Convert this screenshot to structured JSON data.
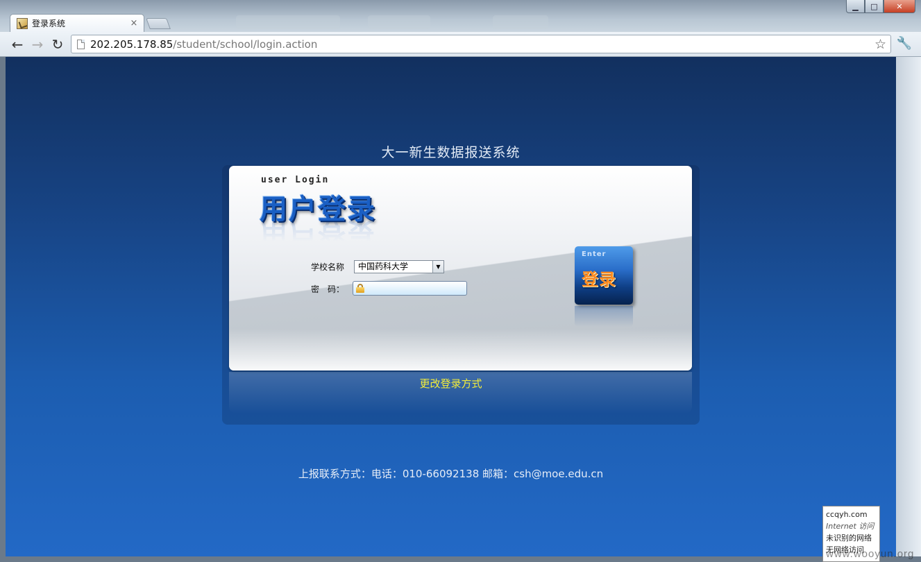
{
  "browser": {
    "tab_title": "登录系统",
    "tab_close": "×",
    "url_host": "202.205.178.85",
    "url_path": "/student/school/login.action",
    "back_glyph": "←",
    "forward_glyph": "→",
    "reload_glyph": "↻",
    "star_glyph": "☆",
    "wrench_glyph": "🔧",
    "window_controls": {
      "minimize": "▁",
      "maximize": "□",
      "close": "✕"
    }
  },
  "page": {
    "system_title": "大一新生数据报送系统",
    "login_heading_en": "user Login",
    "login_heading_cn": "用户登录",
    "school_label": "学校名称",
    "school_selected": "中国药科大学",
    "password_label": "密　码：",
    "password_value": "",
    "enter_en": "Enter",
    "enter_cn": "登录",
    "change_login_link": "更改登录方式",
    "contact_info": "上报联系方式：电话：010-66092138 邮箱：csh@moe.edu.cn"
  },
  "tray": {
    "line1": "ccqyh.com",
    "line2": "Internet 访问",
    "line3": "未识别的网络",
    "line4": "无网络访问"
  },
  "watermark": "www.wooyun.org",
  "colors": {
    "link_yellow": "#f4ee3a",
    "heading_blue": "#1a5fc4",
    "enter_orange": "#ff8a1f"
  }
}
